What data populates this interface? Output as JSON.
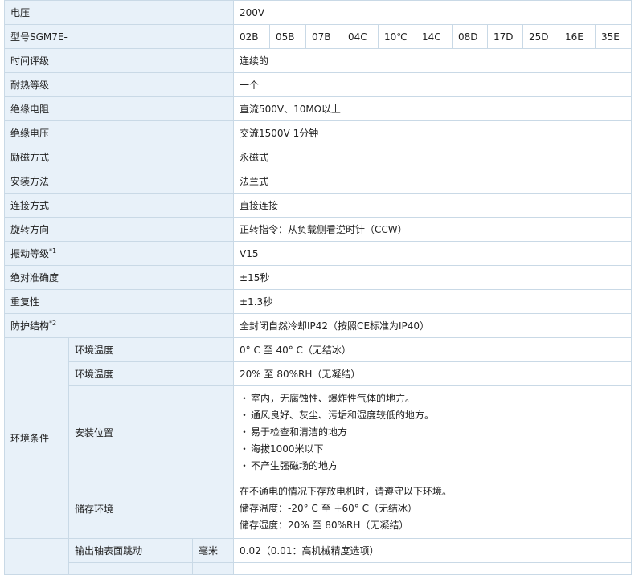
{
  "rows": {
    "voltage": {
      "label": "电压",
      "value": "200V"
    },
    "model": {
      "label": "型号SGM7E-",
      "codes": [
        "02B",
        "05B",
        "07B",
        "04C",
        "10℃",
        "14C",
        "08D",
        "17D",
        "25D",
        "16E",
        "35E"
      ]
    },
    "time_rating": {
      "label": "时间评级",
      "value": "连续的"
    },
    "heat_class": {
      "label": "耐热等级",
      "value": "一个"
    },
    "insulation_resistance": {
      "label": "绝缘电阻",
      "value": "直流500V、10MΩ以上"
    },
    "insulation_voltage": {
      "label": "绝缘电压",
      "value": "交流1500V 1分钟"
    },
    "excitation": {
      "label": "励磁方式",
      "value": "永磁式"
    },
    "mounting": {
      "label": "安装方法",
      "value": "法兰式"
    },
    "connection": {
      "label": "连接方式",
      "value": "直接连接"
    },
    "rotation": {
      "label": "旋转方向",
      "value": "正转指令：从负载侧看逆时针（CCW）"
    },
    "vibration": {
      "label": "振动等级",
      "note": "*1",
      "value": "V15"
    },
    "abs_accuracy": {
      "label": "绝对准确度",
      "value": "±15秒"
    },
    "repeatability": {
      "label": "重复性",
      "value": "±1.3秒"
    },
    "protection": {
      "label": "防护结构",
      "note": "*2",
      "value": "全封闭自然冷却IP42（按照CE标准为IP40）"
    }
  },
  "environment": {
    "label": "环境条件",
    "ambient_temp": {
      "label": "环境温度",
      "value": "0° C 至 40° C（无结冰）"
    },
    "ambient_humidity": {
      "label": "环境温度",
      "value": "20% 至 80%RH（无凝结）"
    },
    "install_location": {
      "label": "安装位置",
      "bullet": "・",
      "items": [
        "室内，无腐蚀性、爆炸性气体的地方。",
        "通风良好、灰尘、污垢和湿度较低的地方。",
        "易于检查和清洁的地方",
        "海拔1000米以下",
        "不产生强磁场的地方"
      ]
    },
    "storage": {
      "label": "储存环境",
      "lines": [
        "在不通电的情况下存放电机时，请遵守以下环境。",
        "储存温度：-20° C 至 +60° C（无结冰）",
        "储存湿度：20% 至 80%RH（无凝结）"
      ]
    }
  },
  "runout": {
    "label": "输出轴表面跳动",
    "unit": "毫米",
    "value": "0.02（0.01：高机械精度选项）"
  }
}
